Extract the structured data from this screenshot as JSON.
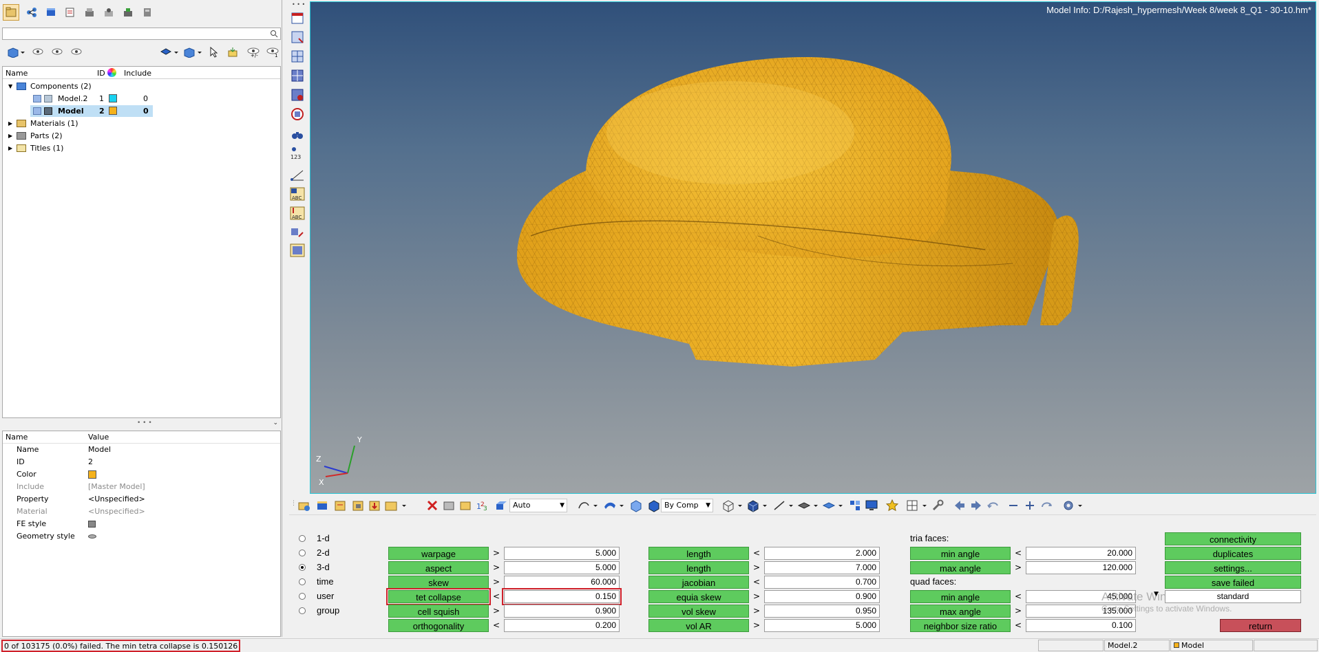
{
  "window": {
    "model_info": "Model Info: D:/Rajesh_hypermesh/Week 8/week 8_Q1 - 30-10.hm*"
  },
  "browser": {
    "columns": {
      "name": "Name",
      "id": "ID",
      "include": "Include"
    },
    "tree": [
      {
        "label": "Components (2)"
      },
      {
        "label": "Model.2",
        "id": "1",
        "include": "0",
        "color": "#19d2f0"
      },
      {
        "label": "Model",
        "id": "2",
        "include": "0",
        "color": "#f5b21c"
      },
      {
        "label": "Materials (1)"
      },
      {
        "label": "Parts (2)"
      },
      {
        "label": "Titles (1)"
      }
    ]
  },
  "properties": {
    "columns": {
      "name": "Name",
      "value": "Value"
    },
    "rows": [
      {
        "key": "Name",
        "value": "Model"
      },
      {
        "key": "ID",
        "value": "2"
      },
      {
        "key": "Color",
        "value": "",
        "color": "#f5b21c"
      },
      {
        "key": "Include",
        "value": "[Master Model]"
      },
      {
        "key": "Property",
        "value": "<Unspecified>"
      },
      {
        "key": "Material",
        "value": "<Unspecified>"
      },
      {
        "key": "FE style",
        "value": ""
      },
      {
        "key": "Geometry style",
        "value": ""
      }
    ]
  },
  "triad": {
    "x": "X",
    "y": "Y",
    "z": "Z"
  },
  "vtool": {
    "count_label": "123"
  },
  "bottom_toolbar": {
    "auto_label": "Auto",
    "color_mode": "By Comp"
  },
  "quality": {
    "dims": [
      {
        "label": "1-d",
        "selected": false
      },
      {
        "label": "2-d",
        "selected": false
      },
      {
        "label": "3-d",
        "selected": true
      },
      {
        "label": "time",
        "selected": false
      },
      {
        "label": "user",
        "selected": false
      },
      {
        "label": "group",
        "selected": false
      }
    ],
    "col1": [
      {
        "label": "warpage",
        "op": ">",
        "value": "5.000"
      },
      {
        "label": "aspect",
        "op": ">",
        "value": "5.000"
      },
      {
        "label": "skew",
        "op": ">",
        "value": "60.000"
      },
      {
        "label": "tet collapse",
        "op": "<",
        "value": "0.150"
      },
      {
        "label": "cell squish",
        "op": ">",
        "value": "0.900"
      },
      {
        "label": "orthogonality",
        "op": "<",
        "value": "0.200"
      }
    ],
    "col2": [
      {
        "label": "length",
        "op": "<",
        "value": "2.000"
      },
      {
        "label": "length",
        "op": ">",
        "value": "7.000"
      },
      {
        "label": "jacobian",
        "op": "<",
        "value": "0.700"
      },
      {
        "label": "equia skew",
        "op": ">",
        "value": "0.900"
      },
      {
        "label": "vol skew",
        "op": ">",
        "value": "0.950"
      },
      {
        "label": "vol AR",
        "op": ">",
        "value": "5.000"
      }
    ],
    "tria_label": "tria faces:",
    "quad_label": "quad faces:",
    "col3": [
      {
        "label": "min angle",
        "op": "<",
        "value": "20.000"
      },
      {
        "label": "max angle",
        "op": ">",
        "value": "120.000"
      },
      {
        "label": "min angle",
        "op": "<",
        "value": "45.000"
      },
      {
        "label": "max angle",
        "op": ">",
        "value": "135.000"
      },
      {
        "label": "neighbor size ratio",
        "op": "<",
        "value": "0.100"
      }
    ],
    "actions": {
      "connectivity": "connectivity",
      "duplicates": "duplicates",
      "settings": "settings...",
      "save_failed": "save failed",
      "standard": "standard",
      "return": "return"
    },
    "watermark_title": "Activate Windows",
    "watermark_sub": "Go to Settings to activate Windows."
  },
  "status": {
    "message": "0 of 103175 (0.0%) failed.  The min tetra collapse is 0.150126",
    "cell_model": "Model.2",
    "cell_comp": "Model"
  },
  "colors": {
    "accent_green": "#5ecb5e",
    "return_red": "#c8505a",
    "mesh_orange": "#e8a51c",
    "highlight_red": "#d0202a"
  }
}
